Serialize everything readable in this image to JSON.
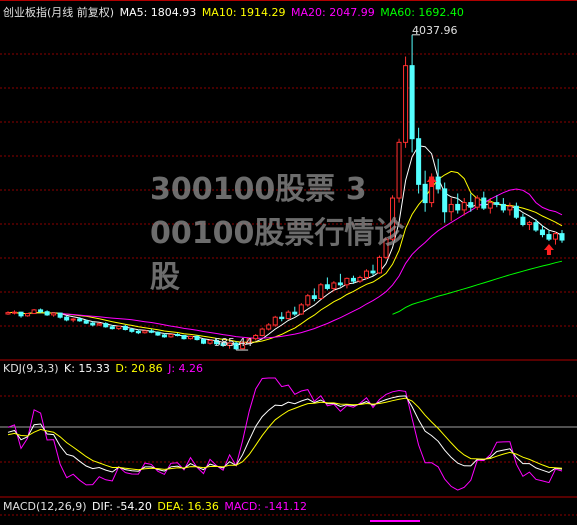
{
  "main_panel": {
    "title": "创业板指(月线 前复权)",
    "ma": [
      {
        "label": "MA5: 1804.93",
        "color": "#ffffff"
      },
      {
        "label": "MA10: 1914.29",
        "color": "#ffff00"
      },
      {
        "label": "MA20: 2047.99",
        "color": "#ff00ff"
      },
      {
        "label": "MA60: 1692.40",
        "color": "#00ff00"
      }
    ],
    "high_label": "4037.96",
    "low_label": "585.44"
  },
  "kdj_panel": {
    "title": "KDJ(9,3,3)",
    "k": "K: 15.33",
    "d": "D: 20.86",
    "j": "J: 4.26",
    "colors": {
      "k": "#ffffff",
      "d": "#ffff00",
      "j": "#ff00ff"
    }
  },
  "macd_panel": {
    "title": "MACD(12,26,9)",
    "dif": "DIF: -54.20",
    "dea": "DEA: 16.36",
    "macd": "MACD: -141.12",
    "colors": {
      "dif": "#ffffff",
      "dea": "#ffff00",
      "macd": "#ff00ff"
    }
  },
  "watermark": {
    "line1": "300100股票 3",
    "line2": "00100股票行情诊",
    "line3": "股"
  },
  "colors": {
    "up": "#ff3030",
    "down": "#54ffff",
    "grid": "#8b0000",
    "background": "#000000"
  },
  "chart_data": [
    {
      "type": "candlestick",
      "title": "创业板指(月线 前复权)",
      "ohlc": [
        [
          980,
          1010,
          970,
          995
        ],
        [
          995,
          1020,
          975,
          1000
        ],
        [
          1000,
          1005,
          940,
          960
        ],
        [
          960,
          990,
          950,
          985
        ],
        [
          985,
          1035,
          980,
          1025
        ],
        [
          1025,
          1040,
          990,
          1005
        ],
        [
          1005,
          1020,
          960,
          970
        ],
        [
          970,
          1000,
          950,
          990
        ],
        [
          990,
          995,
          930,
          945
        ],
        [
          945,
          960,
          900,
          915
        ],
        [
          915,
          935,
          890,
          925
        ],
        [
          925,
          945,
          895,
          905
        ],
        [
          905,
          920,
          870,
          880
        ],
        [
          880,
          900,
          845,
          860
        ],
        [
          860,
          885,
          850,
          875
        ],
        [
          875,
          890,
          830,
          840
        ],
        [
          840,
          860,
          810,
          820
        ],
        [
          820,
          850,
          805,
          845
        ],
        [
          845,
          860,
          800,
          810
        ],
        [
          810,
          830,
          775,
          790
        ],
        [
          790,
          810,
          760,
          775
        ],
        [
          775,
          800,
          765,
          795
        ],
        [
          795,
          815,
          770,
          780
        ],
        [
          780,
          790,
          740,
          750
        ],
        [
          750,
          770,
          720,
          730
        ],
        [
          730,
          760,
          720,
          755
        ],
        [
          755,
          770,
          735,
          745
        ],
        [
          745,
          750,
          700,
          710
        ],
        [
          710,
          740,
          700,
          735
        ],
        [
          735,
          745,
          690,
          700
        ],
        [
          700,
          715,
          650,
          660
        ],
        [
          660,
          700,
          645,
          690
        ],
        [
          690,
          710,
          640,
          655
        ],
        [
          655,
          670,
          620,
          635
        ],
        [
          635,
          670,
          600,
          660
        ],
        [
          660,
          680,
          585.44,
          600
        ],
        [
          600,
          680,
          595,
          670
        ],
        [
          670,
          720,
          660,
          710
        ],
        [
          710,
          760,
          690,
          745
        ],
        [
          745,
          830,
          735,
          815
        ],
        [
          815,
          880,
          800,
          860
        ],
        [
          860,
          960,
          840,
          945
        ],
        [
          945,
          1000,
          900,
          930
        ],
        [
          930,
          1020,
          920,
          1000
        ],
        [
          1000,
          1060,
          960,
          980
        ],
        [
          980,
          1100,
          970,
          1080
        ],
        [
          1080,
          1200,
          1060,
          1180
        ],
        [
          1180,
          1260,
          1120,
          1150
        ],
        [
          1150,
          1320,
          1140,
          1300
        ],
        [
          1300,
          1380,
          1240,
          1260
        ],
        [
          1260,
          1340,
          1230,
          1320
        ],
        [
          1320,
          1420,
          1280,
          1300
        ],
        [
          1300,
          1380,
          1260,
          1370
        ],
        [
          1370,
          1400,
          1310,
          1340
        ],
        [
          1340,
          1400,
          1320,
          1380
        ],
        [
          1380,
          1470,
          1360,
          1450
        ],
        [
          1450,
          1520,
          1400,
          1430
        ],
        [
          1430,
          1620,
          1420,
          1600
        ],
        [
          1600,
          1820,
          1580,
          1800
        ],
        [
          1800,
          2280,
          1780,
          2250
        ],
        [
          2250,
          2900,
          2200,
          2860
        ],
        [
          2860,
          3800,
          2800,
          3700
        ],
        [
          3700,
          4037.96,
          2750,
          2900
        ],
        [
          2900,
          3020,
          2300,
          2400
        ],
        [
          2400,
          2550,
          2100,
          2200
        ],
        [
          2200,
          2520,
          2150,
          2480
        ],
        [
          2480,
          2680,
          2300,
          2350
        ],
        [
          2350,
          2420,
          1980,
          2100
        ],
        [
          2100,
          2250,
          2000,
          2180
        ],
        [
          2180,
          2300,
          2080,
          2120
        ],
        [
          2120,
          2250,
          2060,
          2200
        ],
        [
          2200,
          2300,
          2100,
          2150
        ],
        [
          2150,
          2280,
          2120,
          2250
        ],
        [
          2250,
          2320,
          2120,
          2140
        ],
        [
          2140,
          2250,
          2080,
          2200
        ],
        [
          2200,
          2280,
          2150,
          2180
        ],
        [
          2180,
          2250,
          2090,
          2120
        ],
        [
          2120,
          2200,
          2060,
          2160
        ],
        [
          2160,
          2200,
          2020,
          2040
        ],
        [
          2040,
          2080,
          1940,
          1960
        ],
        [
          1960,
          2000,
          1900,
          1980
        ],
        [
          1980,
          2020,
          1880,
          1900
        ],
        [
          1900,
          1950,
          1820,
          1850
        ],
        [
          1850,
          1900,
          1780,
          1800
        ],
        [
          1800,
          1880,
          1740,
          1860
        ],
        [
          1860,
          1900,
          1760,
          1790
        ]
      ],
      "ylim": [
        520,
        4200
      ]
    }
  ]
}
